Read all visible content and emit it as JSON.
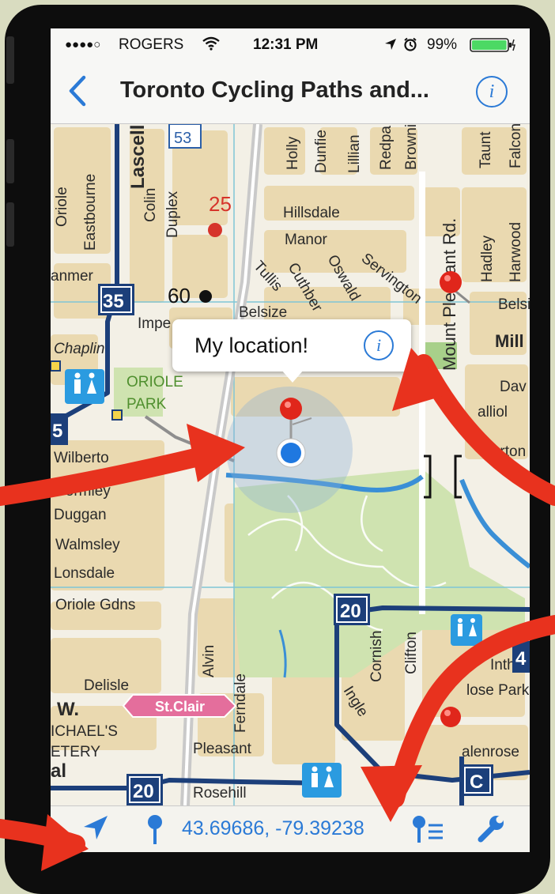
{
  "status_bar": {
    "signal": "●●●●○",
    "carrier": "ROGERS",
    "time": "12:31 PM",
    "battery": "99%",
    "battery_level": 0.99
  },
  "nav_bar": {
    "title": "Toronto Cycling Paths and...",
    "info_glyph": "i"
  },
  "map": {
    "streets": [
      "Holly",
      "Dunfie",
      "Lillian",
      "Redpa",
      "Browni",
      "Taunt",
      "Falcon",
      "Oriole",
      "Eastbourne",
      "Lascelle",
      "Colin",
      "Duplex",
      "Hillsdale",
      "Manor",
      "Tullis",
      "Cuthber",
      "Oswald",
      "Servington",
      "Mount Pleasant Rd.",
      "Hadley",
      "Harwood",
      "Belsize",
      "Belsi",
      "Impe",
      "anmer",
      "Chaplin",
      "Mill",
      "Dav",
      "alliol",
      "Merton",
      "Wilberto",
      "Gormley",
      "Duggan",
      "Walmsley",
      "Lonsdale",
      "Oriole Gdns",
      "Alvin",
      "Ferndale",
      "Cornish",
      "Clifton",
      "Delisle",
      "W.",
      "ICHAEL'S",
      "ETERY",
      "al",
      "Pleasant",
      "Rosehill",
      "Ingle",
      "Inth",
      "lose Park",
      "alenrose"
    ],
    "park_labels": [
      "ORIOLE",
      "PARK"
    ],
    "route_badges": [
      "53",
      "35",
      "5",
      "20",
      "20",
      "C",
      "4"
    ],
    "stop_numbers": [
      "25",
      "60"
    ],
    "station_label": "St.Clair",
    "callout": {
      "text": "My location!",
      "info_glyph": "i"
    }
  },
  "toolbar": {
    "coordinates": "43.69686, -79.39238"
  },
  "colors": {
    "accent": "#2b7ad6",
    "route": "#1c3f7a",
    "pin": "#e0261b",
    "annotation_arrow": "#e8321e",
    "block": "#ead9b0",
    "park": "#cfe3b0"
  },
  "icons": [
    "back-chevron-icon",
    "info-icon",
    "wifi-icon",
    "location-arrow-icon",
    "alarm-icon",
    "battery-icon",
    "map-pin-icon",
    "pin-list-icon",
    "wrench-icon",
    "washroom-icon"
  ]
}
